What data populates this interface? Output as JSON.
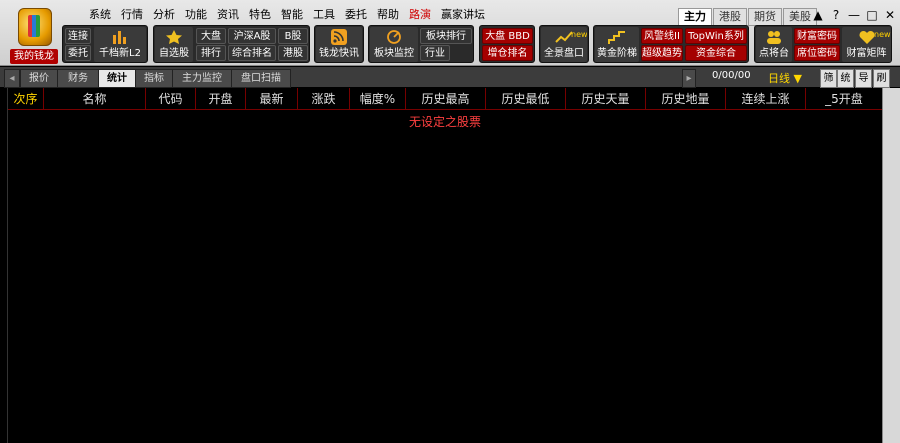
{
  "app": {
    "logo_label": "我的钱龙"
  },
  "menu": [
    "系统",
    "行情",
    "分析",
    "功能",
    "资讯",
    "特色",
    "智能",
    "工具",
    "委托",
    "帮助",
    "路演",
    "赢家讲坛"
  ],
  "menu_highlight_index": 10,
  "mode_tabs": [
    "主力",
    "港股",
    "期货",
    "美股"
  ],
  "window_controls": [
    "▲",
    "?",
    "—",
    "□",
    "✕"
  ],
  "toolbar": {
    "connect": "连接",
    "entrust": "委托",
    "qianlang": "千档新L2",
    "zixuan": "自选股",
    "dapan": "大盘",
    "hushen_a": "沪深A股",
    "b_share": "B股",
    "paihang": "排行",
    "zonghe": "综合排名",
    "ganggu": "港股",
    "kuaixun": "钱龙快讯",
    "bankuai_jiankong": "板块监控",
    "bankuai_paihang": "板块排行",
    "hangye": "行业",
    "bbd": "大盘 BBD",
    "zengcang": "增仓排名",
    "quanjing": "全景盘口",
    "huangjin": "黄金阶梯",
    "fengxian": "风警线II",
    "topwin": "TopWin系列",
    "chaoji": "超级趋势",
    "zijin": "资金综合",
    "dianjiang": "点将台",
    "caifu_mima": "财富密码",
    "xiwei_mima": "席位密码",
    "caifu_juzhen": "财富矩阵",
    "new_badge": "new"
  },
  "tabs": [
    "报价",
    "财务",
    "统计",
    "指标",
    "主力监控",
    "盘口扫描"
  ],
  "active_tab_index": 2,
  "status": {
    "date": "0/00/00",
    "period": "日线 ▼"
  },
  "side_buttons": [
    "筛",
    "统",
    "导",
    "刷"
  ],
  "columns": [
    "次序",
    "名称",
    "代码",
    "开盘",
    "最新",
    "涨跌",
    "幅度%",
    "历史最高",
    "历史最低",
    "历史天量",
    "历史地量",
    "连续上涨",
    "_5开盘"
  ],
  "empty_message": "无设定之股票",
  "colors": {
    "header_divider": "#700000",
    "empty_text": "#ff4040",
    "first_col": "#ffd400"
  }
}
